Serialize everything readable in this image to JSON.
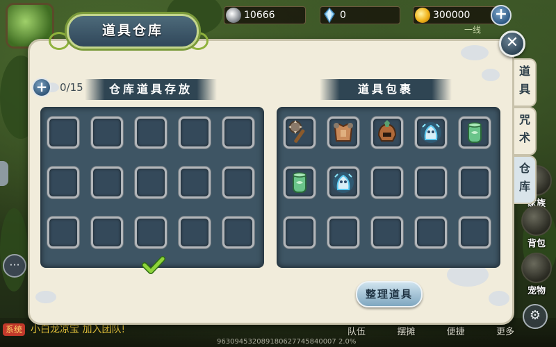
{
  "currency": {
    "silver": "10666",
    "gems": "0",
    "gold": "300000",
    "add_label": "+",
    "line_label": "一线"
  },
  "panel": {
    "title": "道具仓库",
    "close_label": "✕"
  },
  "warehouse": {
    "title": "仓库道具存放",
    "capacity": "0/15",
    "add_label": "+",
    "slots": [
      "",
      "",
      "",
      "",
      "",
      "",
      "",
      "",
      "",
      "",
      "",
      "",
      "",
      "",
      ""
    ]
  },
  "inventory": {
    "title": "道具包裹",
    "items": [
      "mace-icon",
      "armor-icon",
      "helmet-icon",
      "spirit-icon",
      "scroll-icon",
      "scroll-icon",
      "spirit-icon",
      "",
      "",
      "",
      "",
      "",
      "",
      "",
      ""
    ]
  },
  "sort_button": "整理道具",
  "side_tabs": [
    {
      "label": "道具",
      "active": false
    },
    {
      "label": "咒术",
      "active": false
    },
    {
      "label": "仓库",
      "active": true
    }
  ],
  "side_outer": [
    {
      "label": "家族"
    },
    {
      "label": "背包"
    },
    {
      "label": "宠物"
    }
  ],
  "chat": {
    "tag": "系统",
    "message": "小白龙凉宝  加入团队!"
  },
  "bottom_menu": [
    "队伍",
    "摆摊",
    "便捷",
    "更多"
  ],
  "coords": "963094532089180627745840007 2.0%",
  "colors": {
    "panel_bg": "#f1ecdb",
    "slot_panel": "#3e5564",
    "accent_green": "#8fb23c",
    "gold": "#f0b21a"
  }
}
